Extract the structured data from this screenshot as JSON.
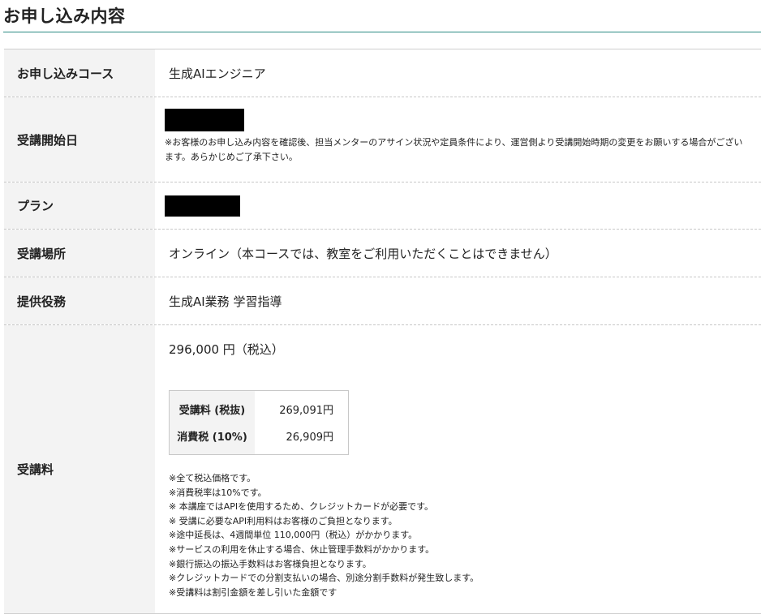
{
  "page": {
    "title": "お申し込み内容"
  },
  "rows": {
    "course": {
      "label": "お申し込みコース",
      "value": "生成AIエンジニア"
    },
    "start_date": {
      "label": "受講開始日",
      "note": "※お客様のお申し込み内容を確認後、担当メンターのアサイン状況や定員条件により、運営側より受講開始時期の変更をお願いする場合がございます。あらかじめご了承下さい。"
    },
    "plan": {
      "label": "プラン"
    },
    "place": {
      "label": "受講場所",
      "value": "オンライン（本コースでは、教室をご利用いただくことはできません）"
    },
    "service": {
      "label": "提供役務",
      "value": "生成AI業務 学習指導"
    },
    "fee": {
      "label": "受講料",
      "total": "296,000 円（税込）",
      "breakdown": [
        {
          "label": "受講料 (税抜)",
          "value": "269,091円"
        },
        {
          "label": "消費税 (10%)",
          "value": "26,909円"
        }
      ],
      "notes": [
        "※全て税込価格です。",
        "※消費税率は10%です。",
        "※ 本講座ではAPIを使用するため、クレジットカードが必要です。",
        "※ 受講に必要なAPI利用料はお客様のご負担となります。",
        "※途中延長は、4週間単位 110,000円（税込）がかかります。",
        "※サービスの利用を休止する場合、休止管理手数料がかかります。",
        "※銀行振込の振込手数料はお客様負担となります。",
        "※クレジットカードでの分割支払いの場合、別途分割手数料が発生致します。",
        "※受講料は割引金額を差し引いた金額です"
      ]
    }
  },
  "colors": {
    "accent_rule": "#2b8a83",
    "header_cell_bg": "#f3f3f3",
    "redaction": "#000000"
  }
}
